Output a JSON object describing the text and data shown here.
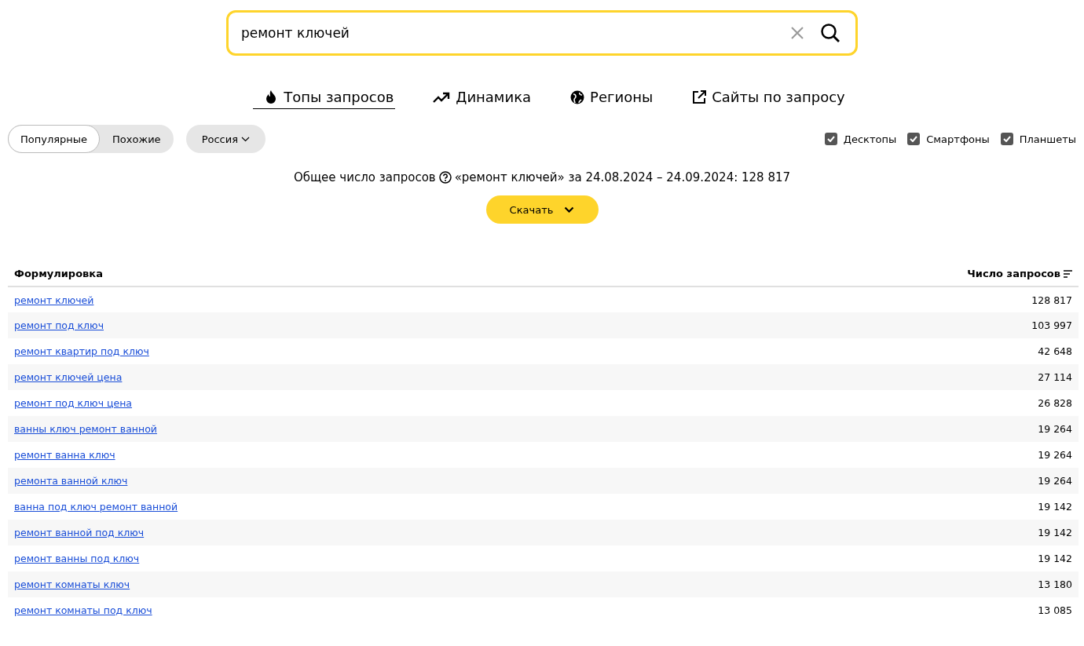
{
  "search": {
    "value": "ремонт ключей"
  },
  "tabs": [
    {
      "label": "Топы запросов",
      "kind": "fire",
      "selected": true
    },
    {
      "label": "Динамика",
      "kind": "trend",
      "selected": false
    },
    {
      "label": "Регионы",
      "kind": "globe",
      "selected": false
    },
    {
      "label": "Сайты по запросу",
      "kind": "external",
      "selected": false
    }
  ],
  "mode_switch": [
    {
      "label": "Популярные",
      "selected": true
    },
    {
      "label": "Похожие",
      "selected": false
    }
  ],
  "region_dropdown": {
    "label": "Россия"
  },
  "devices": [
    {
      "label": "Десктопы",
      "checked": true
    },
    {
      "label": "Смартфоны",
      "checked": true
    },
    {
      "label": "Планшеты",
      "checked": true
    }
  ],
  "summary": {
    "label": "Общее число запросов",
    "text": "«ремонт ключей» за 24.08.2024 – 24.09.2024: 128 817"
  },
  "download_button": {
    "label": "Скачать"
  },
  "table": {
    "columns": [
      "Формулировка",
      "Число запросов"
    ],
    "rows": [
      [
        "ремонт ключей",
        "128 817"
      ],
      [
        "ремонт под ключ",
        "103 997"
      ],
      [
        "ремонт квартир под ключ",
        "42 648"
      ],
      [
        "ремонт ключей цена",
        "27 114"
      ],
      [
        "ремонт под ключ цена",
        "26 828"
      ],
      [
        "ванны ключ ремонт ванной",
        "19 264"
      ],
      [
        "ремонт ванна ключ",
        "19 264"
      ],
      [
        "ремонта ванной ключ",
        "19 264"
      ],
      [
        "ванна под ключ ремонт ванной",
        "19 142"
      ],
      [
        "ремонт ванной под ключ",
        "19 142"
      ],
      [
        "ремонт ванны под ключ",
        "19 142"
      ],
      [
        "ремонт комнаты ключ",
        "13 180"
      ],
      [
        "ремонт комнаты под ключ",
        "13 085"
      ]
    ]
  }
}
